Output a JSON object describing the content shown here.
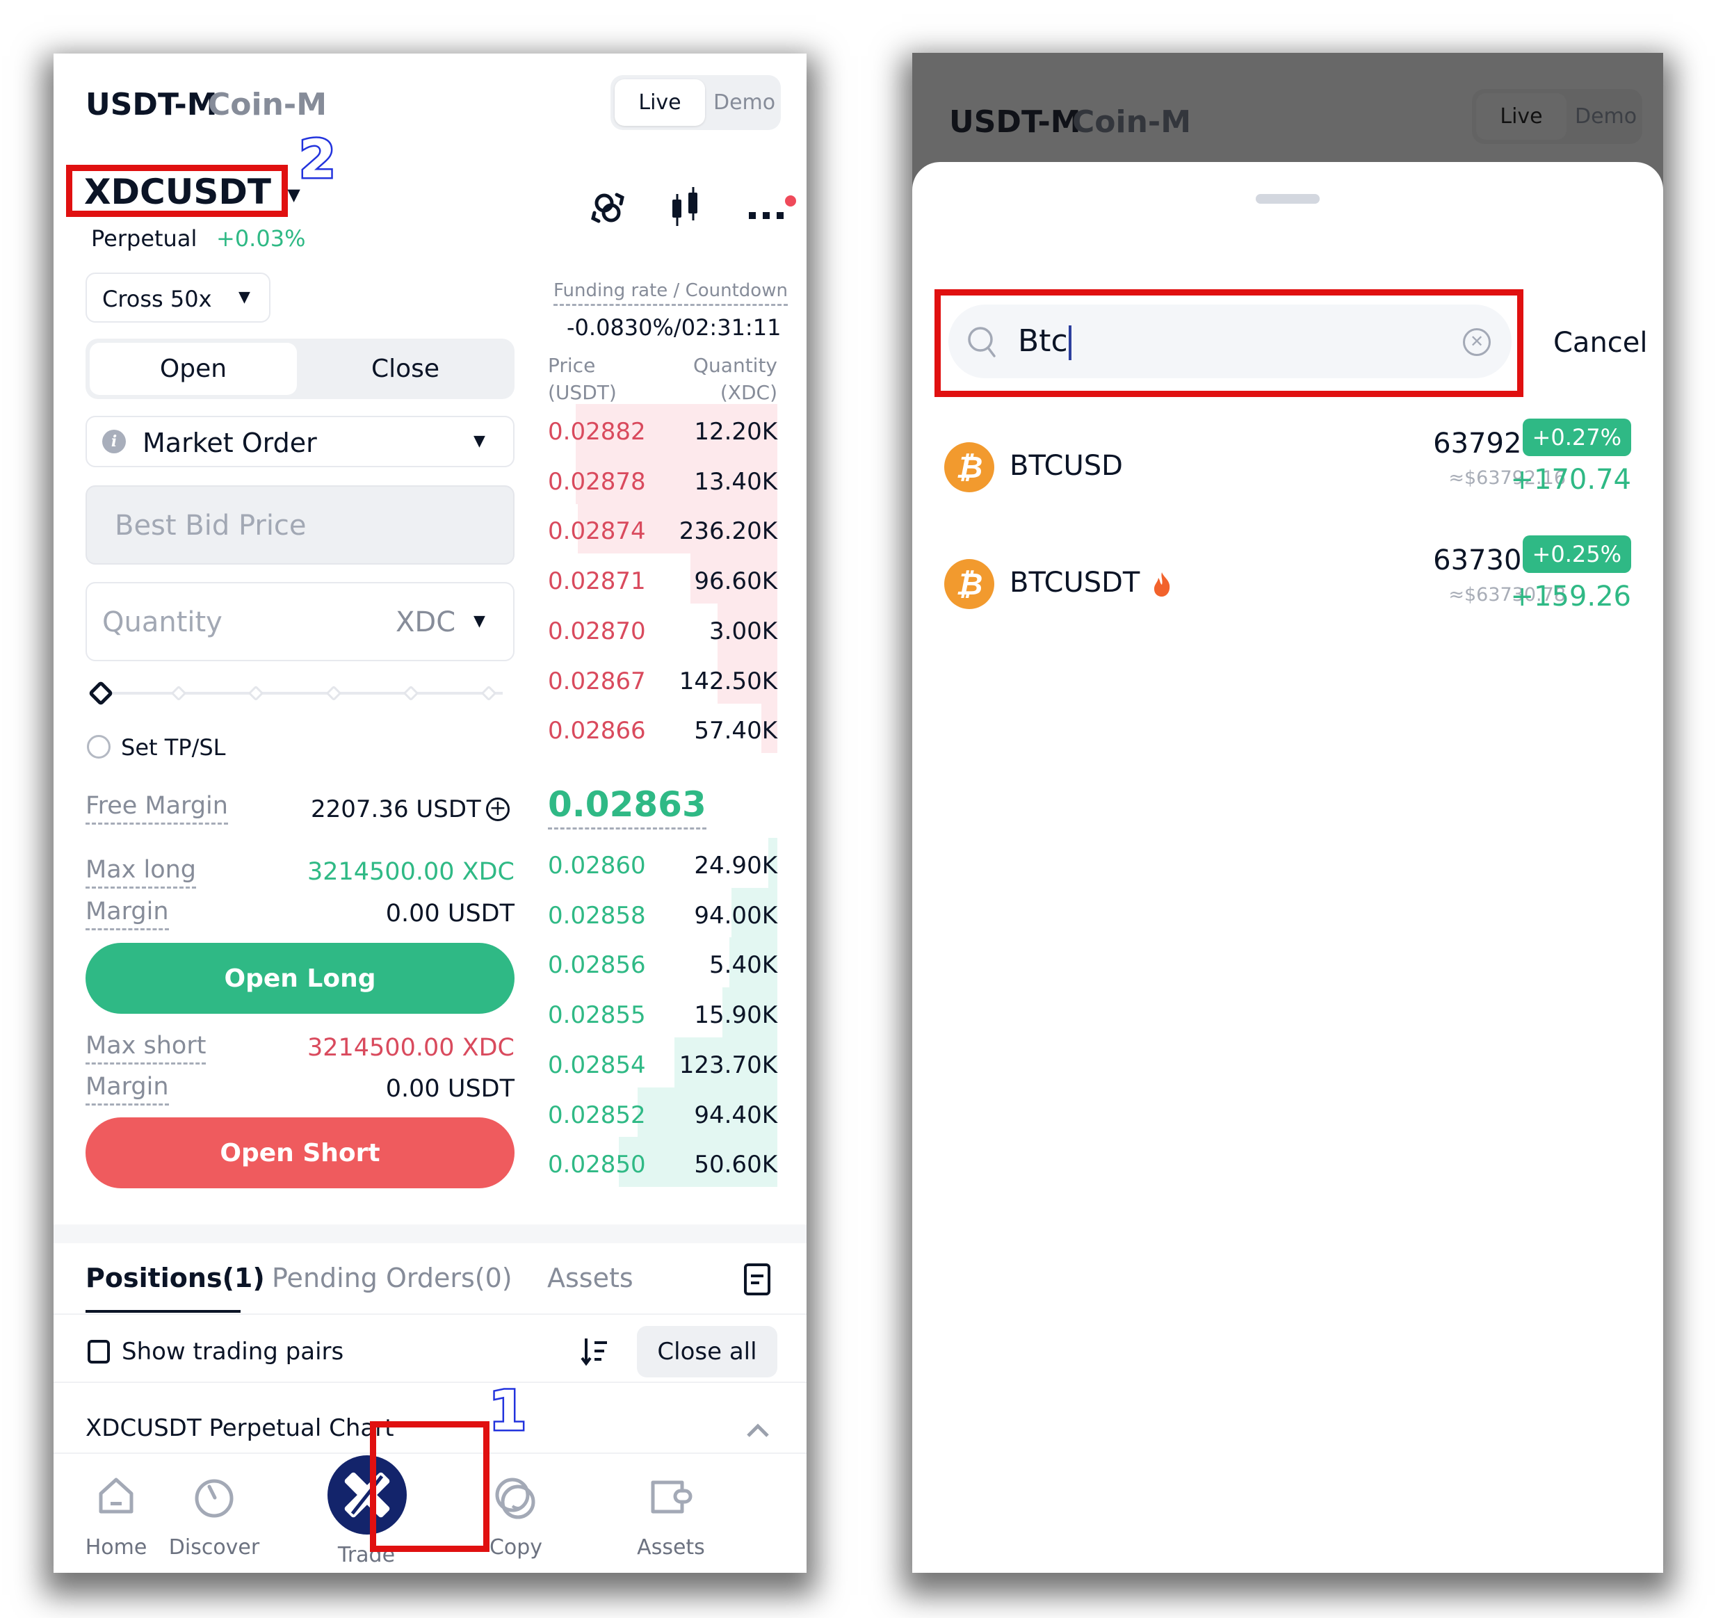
{
  "left_screen": {
    "market_tabs": [
      "USDT-M",
      "Coin-M"
    ],
    "mode_toggle": {
      "options": [
        "Live",
        "Demo"
      ],
      "selected": "Live"
    },
    "symbol": "XDCUSDT",
    "contract_type": "Perpetual",
    "change_pct": "+0.03%",
    "header_icons": [
      "swap-icon",
      "candlestick-chart-icon",
      "more-icon"
    ],
    "margin_mode": "Cross 50x",
    "funding": {
      "label": "Funding rate / Countdown",
      "value": "-0.0830%/02:31:11"
    },
    "side_tabs": {
      "options": [
        "Open",
        "Close"
      ],
      "selected": "Open"
    },
    "order_type": "Market Order",
    "price_field": {
      "placeholder": "Best Bid Price"
    },
    "quantity_field": {
      "placeholder": "Quantity",
      "unit": "XDC"
    },
    "slider": {
      "value_pct": 0,
      "steps": 6
    },
    "tpsl_label": "Set TP/SL",
    "free_margin": {
      "label": "Free Margin",
      "value": "2207.36 USDT"
    },
    "long": {
      "max_label": "Max long",
      "max_value": "3214500.00 XDC",
      "margin_label": "Margin",
      "margin_value": "0.00 USDT",
      "button": "Open Long"
    },
    "short": {
      "max_label": "Max short",
      "max_value": "3214500.00 XDC",
      "margin_label": "Margin",
      "margin_value": "0.00 USDT",
      "button": "Open Short"
    },
    "orderbook": {
      "price_header": [
        "Price",
        "(USDT)"
      ],
      "qty_header": [
        "Quantity",
        "(XDC)"
      ],
      "asks": [
        {
          "price": "0.02882",
          "qty": "12.20K",
          "depth": 0.88
        },
        {
          "price": "0.02878",
          "qty": "13.40K",
          "depth": 0.88
        },
        {
          "price": "0.02874",
          "qty": "236.20K",
          "depth": 0.87
        },
        {
          "price": "0.02871",
          "qty": "96.60K",
          "depth": 0.38
        },
        {
          "price": "0.02870",
          "qty": "3.00K",
          "depth": 0.26
        },
        {
          "price": "0.02867",
          "qty": "142.50K",
          "depth": 0.26
        },
        {
          "price": "0.02866",
          "qty": "57.40K",
          "depth": 0.07
        }
      ],
      "last_price": "0.02863",
      "bids": [
        {
          "price": "0.02860",
          "qty": "24.90K",
          "depth": 0.04
        },
        {
          "price": "0.02858",
          "qty": "94.00K",
          "depth": 0.2
        },
        {
          "price": "0.02856",
          "qty": "5.40K",
          "depth": 0.21
        },
        {
          "price": "0.02855",
          "qty": "15.90K",
          "depth": 0.24
        },
        {
          "price": "0.02854",
          "qty": "123.70K",
          "depth": 0.45
        },
        {
          "price": "0.02852",
          "qty": "94.40K",
          "depth": 0.61
        },
        {
          "price": "0.02850",
          "qty": "50.60K",
          "depth": 0.69
        }
      ]
    },
    "bottom_tabs": {
      "options": [
        "Positions(1)",
        "Pending Orders(0)",
        "Assets"
      ],
      "selected": "Positions(1)"
    },
    "show_pairs_label": "Show trading pairs",
    "close_all": "Close all",
    "chart_row_label": "XDCUSDT Perpetual Chart",
    "nav": [
      {
        "label": "Home",
        "icon": "home-icon"
      },
      {
        "label": "Discover",
        "icon": "discover-icon"
      },
      {
        "label": "Trade",
        "icon": "trade-icon",
        "active": true
      },
      {
        "label": "Copy",
        "icon": "copy-trade-icon"
      },
      {
        "label": "Assets",
        "icon": "wallet-icon"
      }
    ],
    "annotations": {
      "symbol_step": "2",
      "trade_step": "1"
    }
  },
  "right_screen": {
    "market_tabs": [
      "USDT-M",
      "Coin-M"
    ],
    "mode_toggle": {
      "options": [
        "Live",
        "Demo"
      ],
      "selected": "Live"
    },
    "search": {
      "value": "Btc"
    },
    "cancel": "Cancel",
    "results": [
      {
        "symbol": "BTCUSD",
        "hot": false,
        "price": "63792.16",
        "usd_price": "≈$63792.16",
        "change_pct": "+0.27%",
        "change_abs": "+170.74"
      },
      {
        "symbol": "BTCUSDT",
        "hot": true,
        "price": "63730.78",
        "usd_price": "≈$63730.78",
        "change_pct": "+0.25%",
        "change_abs": "+159.26"
      }
    ]
  },
  "colors": {
    "green": "#2fb985",
    "red": "#ef5b5e",
    "ask_text": "#d94a5d",
    "brand_navy": "#13246b",
    "annotation_frame": "#e01010",
    "annotation_number": "#2233dd"
  }
}
